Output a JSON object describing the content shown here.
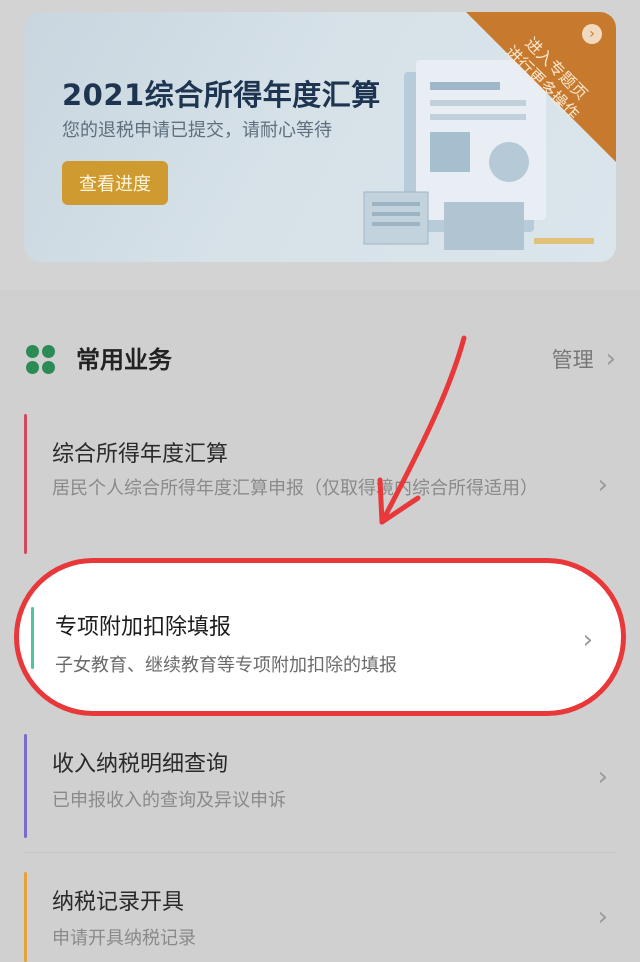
{
  "banner": {
    "title": "2021综合所得年度汇算",
    "subtitle": "您的退税申请已提交，请耐心等待",
    "progress_button": "查看进度",
    "ribbon_line1": "进入专题页",
    "ribbon_line2": "进行更多操作"
  },
  "services": {
    "title": "常用业务",
    "manage_label": "管理",
    "items": [
      {
        "title": "综合所得年度汇算",
        "desc": "居民个人综合所得年度汇算申报（仅取得境内综合所得适用）",
        "accent": "#d14a5a"
      },
      {
        "title": "专项附加扣除填报",
        "desc": "子女教育、继续教育等专项附加扣除的填报",
        "accent": "#4fc59b"
      },
      {
        "title": "收入纳税明细查询",
        "desc": "已申报收入的查询及异议申诉",
        "accent": "#7b6cc9"
      },
      {
        "title": "纳税记录开具",
        "desc": "申请开具纳税记录",
        "accent": "#e3a23c"
      }
    ]
  },
  "annotation": {
    "highlight_color": "#e8383a"
  }
}
